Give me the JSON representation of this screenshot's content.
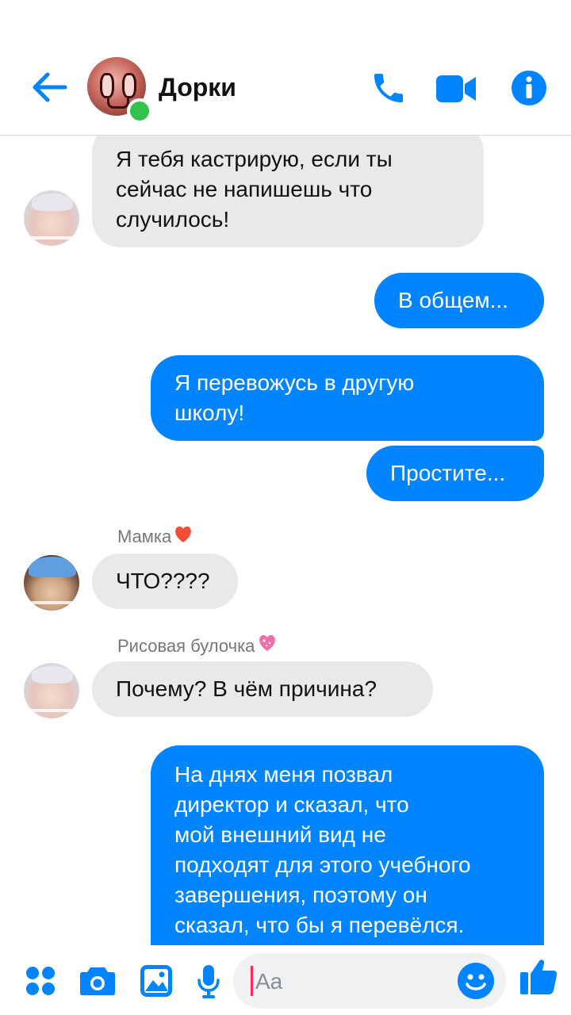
{
  "header": {
    "title": "Дорки",
    "back_icon": "arrow-left-icon",
    "call_icon": "phone-icon",
    "video_icon": "video-camera-icon",
    "info_icon": "info-icon",
    "accent": "#0084ff",
    "online_color": "#31c24d"
  },
  "messages": [
    {
      "side": "in",
      "lines": [
        "Я тебя кастрирую, если ты",
        "сейчас не напишешь что",
        "случилось!"
      ]
    },
    {
      "side": "out",
      "text": "В общем..."
    },
    {
      "side": "out",
      "lines": [
        "Я перевожусь в другую",
        "школу!"
      ]
    },
    {
      "side": "out",
      "text": "Простите..."
    },
    {
      "side": "in",
      "sender": "Мамка",
      "text": "ЧТО????"
    },
    {
      "side": "in",
      "sender": "Рисовая булочка",
      "text": "Почему? В чём причина?"
    },
    {
      "side": "out",
      "lines": [
        "На днях меня позвал",
        "директор и сказал, что",
        "мой внешний вид не",
        "подходят для этого учебного",
        "завершения, поэтому он",
        "сказал, что бы я перевёлся."
      ]
    }
  ],
  "composer": {
    "placeholder": "Aa",
    "icons": [
      "apps-icon",
      "camera-icon",
      "gallery-icon",
      "microphone-icon",
      "emoji-icon",
      "thumbs-up-icon"
    ]
  }
}
